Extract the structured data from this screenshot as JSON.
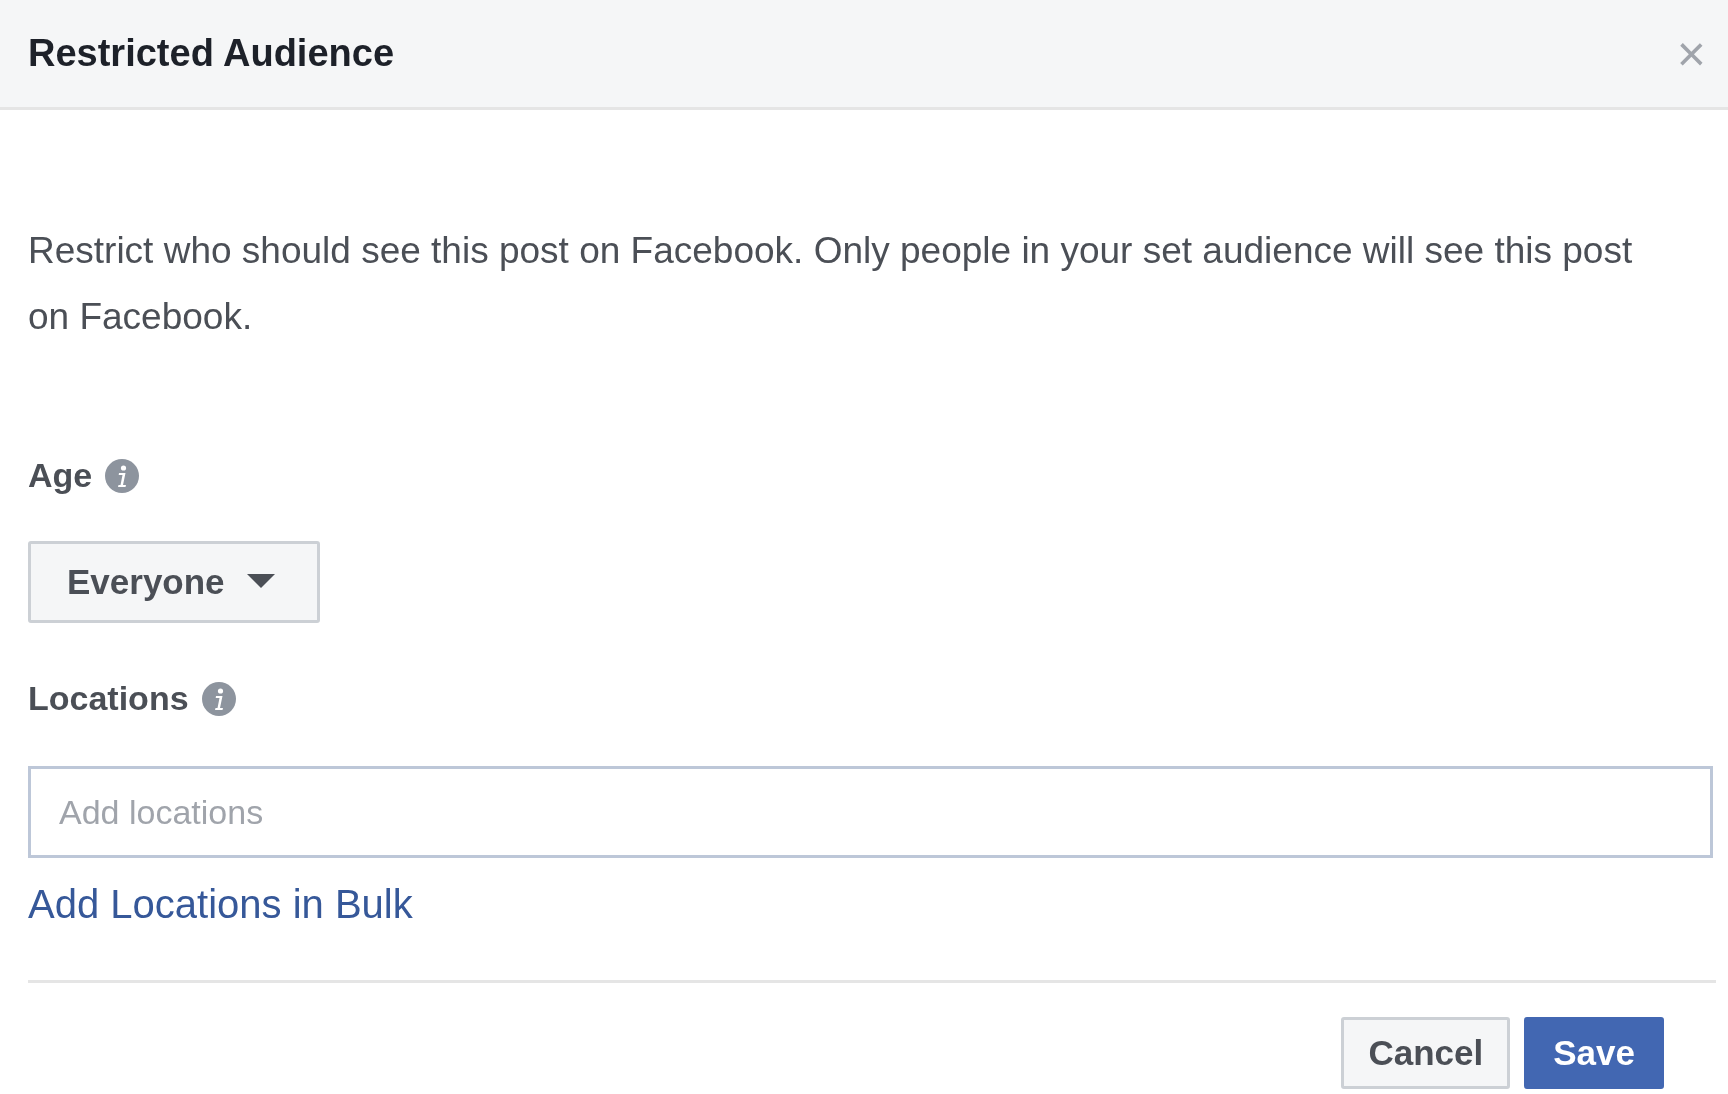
{
  "dialog": {
    "title": "Restricted Audience",
    "close": "×"
  },
  "description": "Restrict who should see this post on Facebook. Only people in your set audience will see this post on Facebook.",
  "age": {
    "label": "Age",
    "value": "Everyone"
  },
  "locations": {
    "label": "Locations",
    "placeholder": "Add locations",
    "bulk_link": "Add Locations in Bulk"
  },
  "buttons": [
    {
      "label": "Cancel",
      "kind": "secondary"
    },
    {
      "label": "Save",
      "kind": "primary"
    }
  ]
}
